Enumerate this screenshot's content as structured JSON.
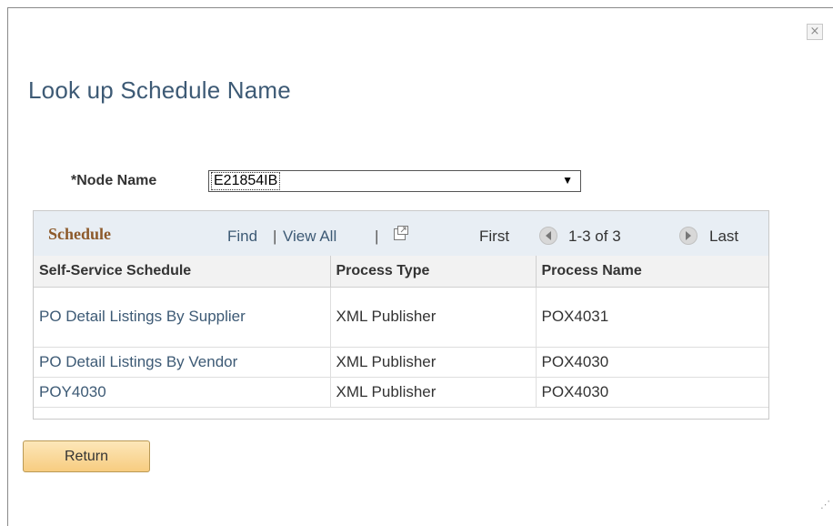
{
  "dialog": {
    "title": "Look up Schedule Name",
    "close_label": "×"
  },
  "node": {
    "label": "*Node Name",
    "selected": "E21854IB",
    "arrow": "▼"
  },
  "grid": {
    "title": "Schedule",
    "find": "Find",
    "sep1": "|",
    "view_all": "View All",
    "sep2": "|",
    "first": "First",
    "range": "1-3 of 3",
    "last": "Last",
    "columns": [
      "Self-Service Schedule",
      "Process Type",
      "Process Name"
    ],
    "rows": [
      {
        "schedule": "PO Detail Listings By Supplier",
        "type": "XML Publisher",
        "name": "POX4031"
      },
      {
        "schedule": "PO Detail Listings By Vendor",
        "type": "XML Publisher",
        "name": "POX4030"
      },
      {
        "schedule": "POY4030",
        "type": "XML Publisher",
        "name": "POX4030"
      }
    ]
  },
  "return_label": "Return",
  "grip": "⋰",
  "icons": {
    "close": "close-icon",
    "zoom": "new-window-icon",
    "prev": "previous-arrow-icon",
    "next": "next-arrow-icon"
  },
  "colors": {
    "title": "#3d5a75",
    "grid_title": "#8d5a2b",
    "header_bg": "#e8eef4",
    "button": "#f7cc80"
  }
}
